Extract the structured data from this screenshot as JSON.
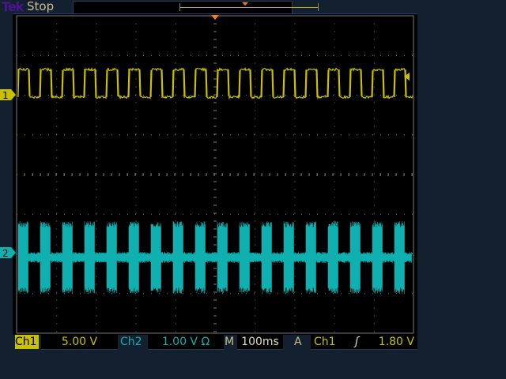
{
  "header": {
    "logo": "Tek",
    "status": "Stop"
  },
  "channels": [
    {
      "label": "Ch1",
      "marker": "1",
      "scale": "5.00 V",
      "color": "#c8c000"
    },
    {
      "label": "Ch2",
      "marker": "2",
      "scale": "1.00 V Ω",
      "color": "#10b0b0"
    }
  ],
  "timebase": {
    "label": "M",
    "value": "100ms"
  },
  "trigger": {
    "label": "A",
    "source": "Ch1",
    "slope_icon": "rising-edge-icon",
    "slope_glyph": "ʃ",
    "level": "1.80 V"
  },
  "colors": {
    "trigger_marker": "#ff8000",
    "graticule": "#7a7a7a"
  }
}
